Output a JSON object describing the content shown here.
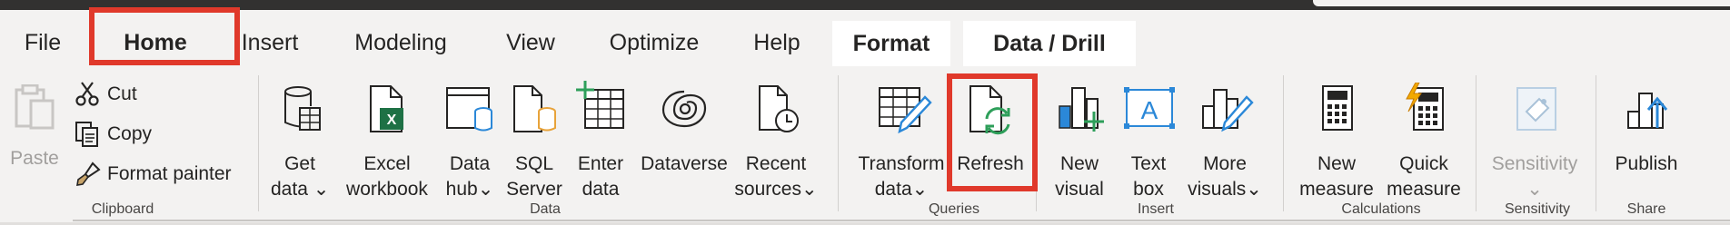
{
  "tabs": {
    "file": "File",
    "home": "Home",
    "insert": "Insert",
    "modeling": "Modeling",
    "view": "View",
    "optimize": "Optimize",
    "help": "Help",
    "format": "Format",
    "data_drill": "Data / Drill"
  },
  "clipboard": {
    "paste": "Paste",
    "cut": "Cut",
    "copy": "Copy",
    "format_painter": "Format painter",
    "group": "Clipboard"
  },
  "data": {
    "get_data": [
      "Get",
      "data"
    ],
    "excel": [
      "Excel",
      "workbook"
    ],
    "data_hub": [
      "Data",
      "hub"
    ],
    "sql": [
      "SQL",
      "Server"
    ],
    "enter": [
      "Enter",
      "data"
    ],
    "dataverse": "Dataverse",
    "recent": [
      "Recent",
      "sources"
    ],
    "group": "Data"
  },
  "queries": {
    "transform": [
      "Transform",
      "data"
    ],
    "refresh": "Refresh",
    "group": "Queries"
  },
  "insert": {
    "new_visual": [
      "New",
      "visual"
    ],
    "text_box": [
      "Text",
      "box"
    ],
    "more_visuals": [
      "More",
      "visuals"
    ],
    "group": "Insert"
  },
  "calculations": {
    "new_measure": [
      "New",
      "measure"
    ],
    "quick_measure": [
      "Quick",
      "measure"
    ],
    "group": "Calculations"
  },
  "sensitivity": {
    "label": "Sensitivity",
    "group": "Sensitivity"
  },
  "share": {
    "publish": "Publish",
    "group": "Share"
  },
  "dropdown_glyph": "⌄",
  "colors": {
    "highlight": "#e0392b",
    "excel_green": "#1e7145",
    "refresh_green": "#2e9f5a",
    "blue": "#2b88d8",
    "ribbon_bg": "#f3f2f1"
  }
}
